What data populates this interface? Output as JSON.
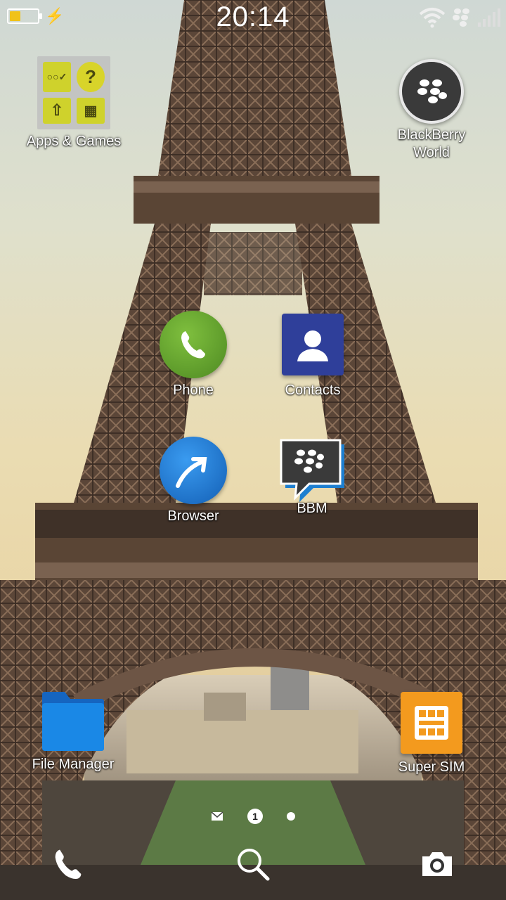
{
  "status": {
    "time": "20:14",
    "battery_level": 0.35,
    "battery_color": "#f0c21a",
    "icons": [
      "battery-icon",
      "charging-bolt-icon",
      "wifi-icon",
      "blackberry-messenger-status-icon",
      "signal-icon"
    ]
  },
  "apps": {
    "apps_games": {
      "label": "Apps & Games",
      "icon": "folder-icon"
    },
    "blackberry_world": {
      "label_line1": "BlackBerry",
      "label_line2": "World",
      "icon": "blackberry-world-icon"
    },
    "phone": {
      "label": "Phone",
      "icon": "phone-icon",
      "color": "#5a9a2a"
    },
    "contacts": {
      "label": "Contacts",
      "icon": "contacts-icon",
      "color": "#2f3f9a"
    },
    "browser": {
      "label": "Browser",
      "icon": "browser-icon",
      "color": "#1f7fd6"
    },
    "bbm": {
      "label": "BBM",
      "icon": "bbm-icon"
    },
    "file_manager": {
      "label": "File Manager",
      "icon": "file-manager-icon",
      "color": "#1a7fe0"
    },
    "super_sim": {
      "label": "Super SIM",
      "icon": "super-sim-icon",
      "color": "#f39a1e"
    }
  },
  "pager": {
    "current_page": "1",
    "pages_total_visible": 2
  },
  "dock": [
    "phone-dock-icon",
    "search-icon",
    "camera-icon"
  ]
}
